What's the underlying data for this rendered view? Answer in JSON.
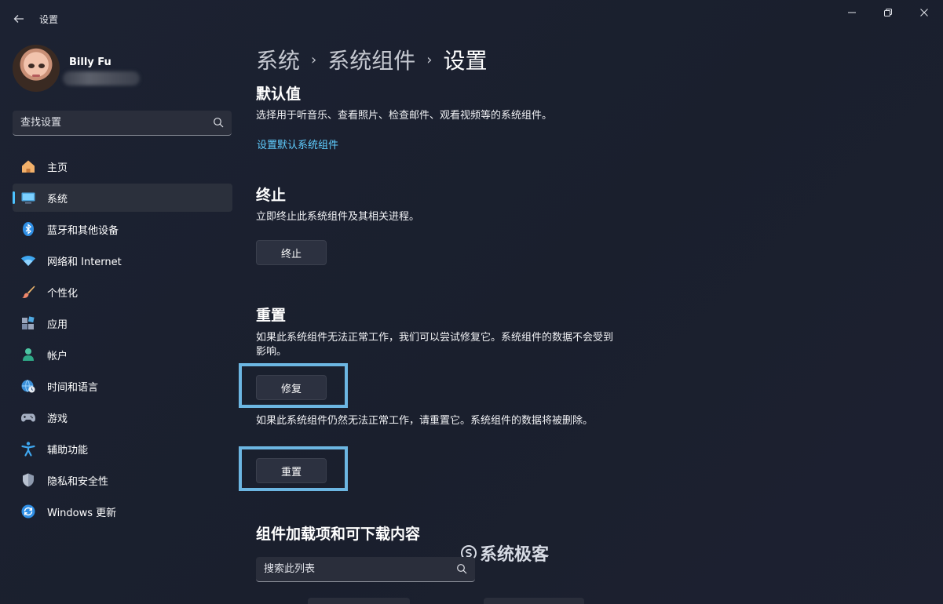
{
  "window": {
    "title": "设置"
  },
  "user": {
    "name": "Billy Fu"
  },
  "search": {
    "placeholder": "查找设置"
  },
  "nav": [
    {
      "label": "主页",
      "icon": "home-icon",
      "active": false
    },
    {
      "label": "系统",
      "icon": "monitor-icon",
      "active": true
    },
    {
      "label": "蓝牙和其他设备",
      "icon": "bluetooth-icon",
      "active": false
    },
    {
      "label": "网络和 Internet",
      "icon": "wifi-icon",
      "active": false
    },
    {
      "label": "个性化",
      "icon": "brush-icon",
      "active": false
    },
    {
      "label": "应用",
      "icon": "apps-icon",
      "active": false
    },
    {
      "label": "帐户",
      "icon": "person-icon",
      "active": false
    },
    {
      "label": "时间和语言",
      "icon": "globe-clock-icon",
      "active": false
    },
    {
      "label": "游戏",
      "icon": "gamepad-icon",
      "active": false
    },
    {
      "label": "辅助功能",
      "icon": "accessibility-icon",
      "active": false
    },
    {
      "label": "隐私和安全性",
      "icon": "shield-icon",
      "active": false
    },
    {
      "label": "Windows 更新",
      "icon": "update-icon",
      "active": false
    }
  ],
  "breadcrumb": [
    "系统",
    "系统组件",
    "设置"
  ],
  "defaults": {
    "title": "默认值",
    "desc": "选择用于听音乐、查看照片、检查邮件、观看视频等的系统组件。",
    "link": "设置默认系统组件"
  },
  "terminate": {
    "title": "终止",
    "desc": "立即终止此系统组件及其相关进程。",
    "button": "终止"
  },
  "reset": {
    "title": "重置",
    "repair_desc": "如果此系统组件无法正常工作，我们可以尝试修复它。系统组件的数据不会受到影响。",
    "repair_button": "修复",
    "reset_desc": "如果此系统组件仍然无法正常工作，请重置它。系统组件的数据将被删除。",
    "reset_button": "重置"
  },
  "addons": {
    "title": "组件加载项和可下载内容",
    "search_placeholder": "搜索此列表"
  },
  "watermark": "系统极客",
  "colors": {
    "accent": "#4cc2ff",
    "link": "#60cdff",
    "highlight_border": "#6cb6e2",
    "background": "#1b2030"
  }
}
